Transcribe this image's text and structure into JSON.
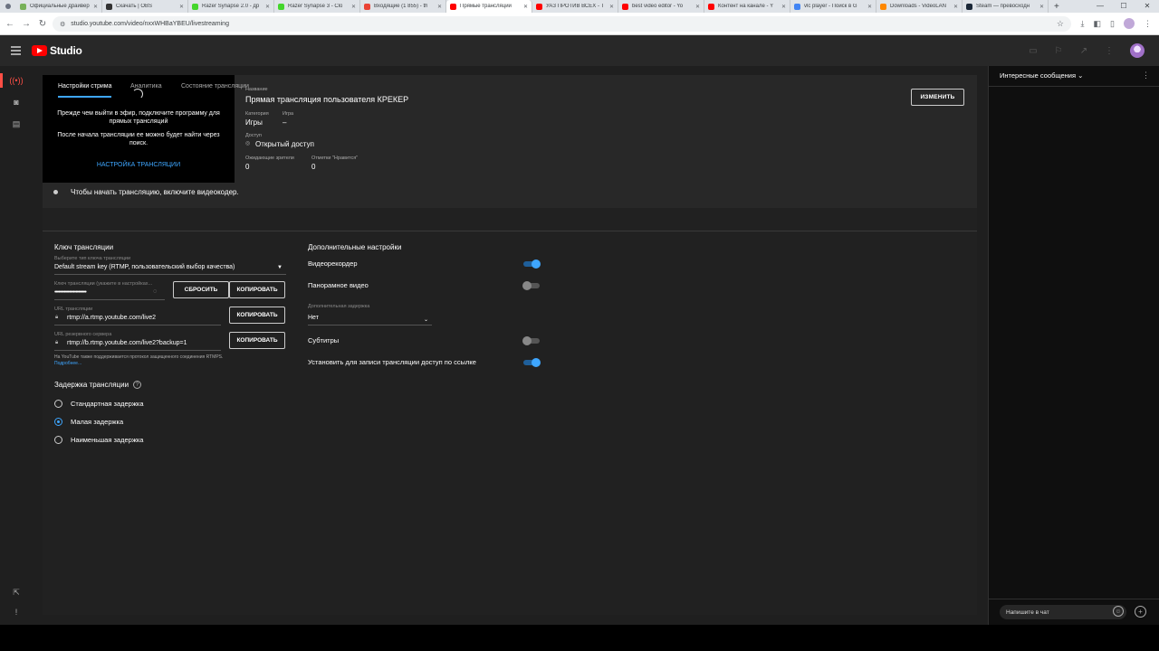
{
  "browser": {
    "tabs": [
      {
        "label": "Официальные драйвер",
        "icon_color": "#78b159"
      },
      {
        "label": "Скачать | OBS",
        "icon_color": "#333333"
      },
      {
        "label": "Razer Synapse 2.0 - др",
        "icon_color": "#44d62c"
      },
      {
        "label": "Razer Synapse 3 - Clo",
        "icon_color": "#44d62c"
      },
      {
        "label": "Входящие (1 855) - th",
        "icon_color": "#ea4335"
      },
      {
        "label": "Прямые трансляции",
        "icon_color": "#ff0000"
      },
      {
        "label": "УАЗ ПРОТИВ ВСЕХ - Т",
        "icon_color": "#ff0000"
      },
      {
        "label": "best video editor - Yo",
        "icon_color": "#ff0000"
      },
      {
        "label": "Контент на канале - Y",
        "icon_color": "#ff0000"
      },
      {
        "label": "vlc player - Поиск в G",
        "icon_color": "#4285f4"
      },
      {
        "label": "Downloads - VideoLAN",
        "icon_color": "#ff8800"
      },
      {
        "label": "Steam — превосходн",
        "icon_color": "#1b2838"
      }
    ],
    "new_tab": "+",
    "url": "studio.youtube.com/video/nxxWHBaYBEU/livestreaming"
  },
  "studio": {
    "logo_text": "Studio"
  },
  "stream": {
    "preview_text_1": "Прежде чем выйти в эфир, подключите программу для прямых трансляций",
    "preview_text_2": "После начала трансляции ее можно будет найти через поиск.",
    "preview_link": "НАСТРОЙКА ТРАНСЛЯЦИИ",
    "encoder_status": "Чтобы начать трансляцию, включите видеокодер.",
    "title_label": "Название",
    "title": "Прямая трансляция пользователя КРЕКЕР",
    "category_label": "Категория",
    "category": "Игры",
    "game_label": "Игра",
    "game": "–",
    "access_label": "Доступ",
    "access": "Открытый доступ",
    "waiting_label": "Ожидающие зрители",
    "waiting": "0",
    "likes_label": "Отметки \"Нравится\"",
    "likes": "0",
    "edit_button": "ИЗМЕНИТЬ"
  },
  "tabs": [
    {
      "label": "Настройки стрима",
      "active": true
    },
    {
      "label": "Аналитика",
      "active": false
    },
    {
      "label": "Состояние трансляции",
      "active": false
    }
  ],
  "key_section": {
    "title": "Ключ трансляции",
    "type_label": "Выберите тип ключа трансляции",
    "type_value": "Default stream key (RTMP, пользовательский выбор качества)",
    "key_label": "Ключ трансляции (укажите в настройках...",
    "key_value": "••••••••••••••••••••••••",
    "reset_button": "СБРОСИТЬ",
    "copy_button": "КОПИРОВАТЬ",
    "url_label": "URL трансляции",
    "url_value": "rtmp://a.rtmp.youtube.com/live2",
    "backup_label": "URL резервного сервера",
    "backup_value": "rtmp://b.rtmp.youtube.com/live2?backup=1",
    "rtmps_note": "На YouTube также поддерживается протокол защищенного соединения RTMPS.",
    "more_link": "Подробнее..."
  },
  "latency": {
    "title": "Задержка трансляции",
    "help_icon": "?",
    "options": [
      {
        "label": "Стандартная задержка",
        "checked": false
      },
      {
        "label": "Малая задержка",
        "checked": true
      },
      {
        "label": "Наименьшая задержка",
        "checked": false
      }
    ]
  },
  "additional": {
    "title": "Дополнительные настройки",
    "dvr_label": "Видеорекордер",
    "dvr_on": true,
    "panorama_label": "Панорамное видео",
    "panorama_on": false,
    "delay_label": "Дополнительная задержка",
    "delay_value": "Нет",
    "subtitles_label": "Субтитры",
    "subtitles_on": false,
    "unlisted_label": "Установить для записи трансляции доступ по ссылке",
    "unlisted_on": true
  },
  "chat": {
    "header": "Интересные сообщения",
    "input_placeholder": "Напишите в чат"
  },
  "colors": {
    "accent": "#3ea6ff",
    "live_red": "#ff4e45",
    "yt_red": "#ff0000"
  }
}
